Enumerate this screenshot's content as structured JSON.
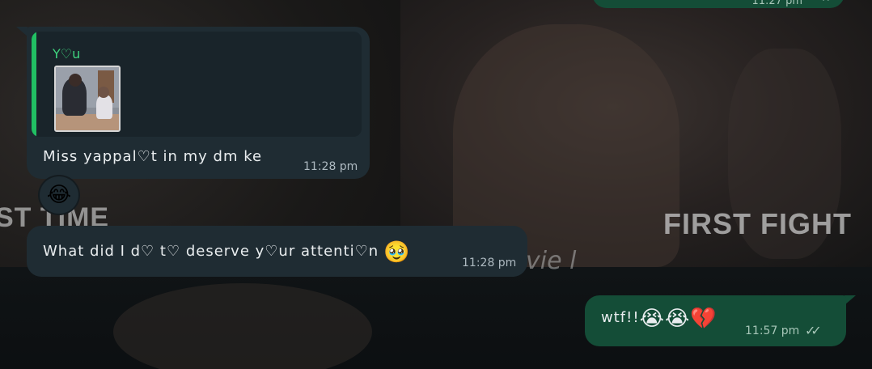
{
  "wallpaper": {
    "left_text": "ST TIME",
    "right_text": "FIRST FIGHT",
    "script_text": "vie l"
  },
  "messages": [
    {
      "direction": "outgoing",
      "time": "11:27 pm",
      "status_icon": "double-check-icon"
    },
    {
      "direction": "incoming",
      "quote": {
        "author": "Y♡u",
        "thumbnail": "image-thumbnail"
      },
      "text": "Miss yappal♡t in my dm ke",
      "time": "11:28 pm",
      "reaction": "😂"
    },
    {
      "direction": "incoming",
      "text": "What did I d♡ t♡ deserve y♡ur attenti♡n",
      "emoji": "🥹",
      "time": "11:28 pm"
    },
    {
      "direction": "outgoing",
      "text": "wtf!!",
      "emoji": "😭😭💔",
      "time": "11:57 pm",
      "status_icon": "double-check-icon",
      "status_color": "#a7c6b8"
    }
  ],
  "colors": {
    "incoming_bubble": "#1f2c33",
    "outgoing_bubble": "#144d37",
    "quote_accent": "#21c063"
  }
}
